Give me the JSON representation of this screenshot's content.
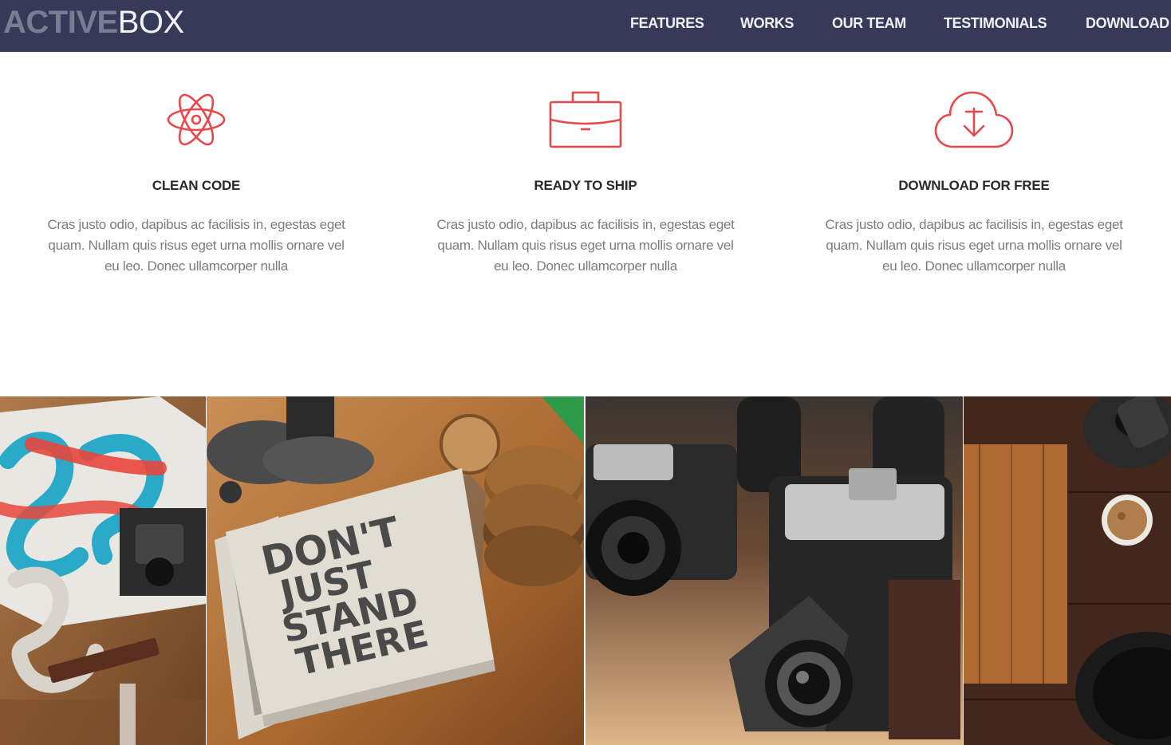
{
  "brand": {
    "bold": "ACTIVE",
    "thin": "BOX"
  },
  "nav": {
    "items": [
      {
        "label": "FEATURES"
      },
      {
        "label": "WORKS"
      },
      {
        "label": "OUR TEAM"
      },
      {
        "label": "TESTIMONIALS"
      },
      {
        "label": "DOWNLOAD"
      }
    ]
  },
  "features": [
    {
      "icon": "atom-icon",
      "title": "CLEAN CODE",
      "text": "Cras justo odio, dapibus ac facilisis in, egestas eget quam. Nullam quis risus eget urna mollis ornare vel eu leo. Donec ullamcorper nulla"
    },
    {
      "icon": "briefcase-icon",
      "title": "READY TO SHIP",
      "text": "Cras justo odio, dapibus ac facilisis in, egestas eget quam. Nullam quis risus eget urna mollis ornare vel eu leo. Donec ullamcorper nulla"
    },
    {
      "icon": "cloud-download-icon",
      "title": "DOWNLOAD FOR FREE",
      "text": "Cras justo odio, dapibus ac facilisis in, egestas eget quam. Nullam quis risus eget urna mollis ornare vel eu leo. Donec ullamcorper nulla"
    }
  ],
  "gallery": {
    "notebook_text": [
      "DON'T",
      "JUST",
      "STAND",
      "THERE"
    ]
  },
  "colors": {
    "navbar": "#363a58",
    "accent": "#e8474c",
    "heading": "#2a2a2a",
    "body_text": "#7c7c7c"
  }
}
